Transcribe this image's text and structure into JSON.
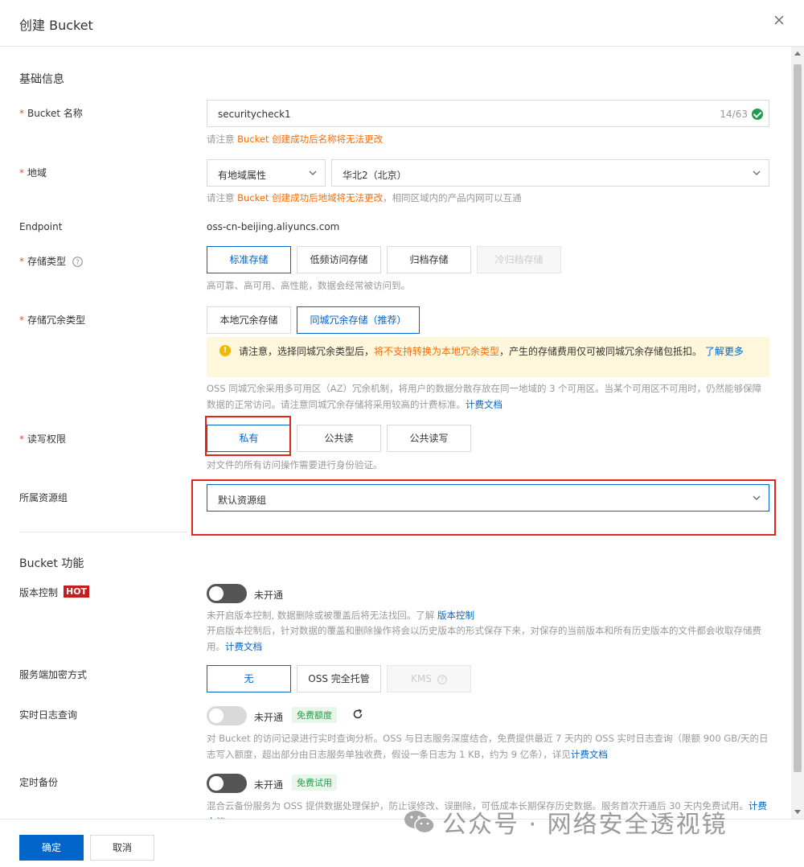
{
  "dialog": {
    "title": "创建 Bucket"
  },
  "basic": {
    "section_title": "基础信息",
    "bucket_name": {
      "label": "Bucket 名称",
      "value": "securitycheck1",
      "count": "14/63",
      "hint_prefix": "请注意 ",
      "hint_orange": "Bucket 创建成功后名称将无法更改"
    },
    "region": {
      "label": "地域",
      "type_value": "有地域属性",
      "region_value": "华北2（北京）",
      "hint_prefix": "请注意 ",
      "hint_orange": "Bucket 创建成功后地域将无法更改",
      "hint_suffix": "，相同区域内的产品内网可以互通"
    },
    "endpoint": {
      "label": "Endpoint",
      "value": "oss-cn-beijing.aliyuncs.com"
    },
    "storage_class": {
      "label": "存储类型",
      "options": [
        "标准存储",
        "低频访问存储",
        "归档存储",
        "冷归档存储"
      ],
      "hint": "高可靠、高可用、高性能，数据会经常被访问到。"
    },
    "redundancy": {
      "label": "存储冗余类型",
      "options": [
        "本地冗余存储",
        "同城冗余存储（推荐）"
      ],
      "notice_prefix": "请注意，选择同城冗余类型后，",
      "notice_red": "将不支持转换为本地冗余类型",
      "notice_suffix": "，产生的存储费用仅可被同城冗余存储包抵扣。",
      "notice_link": "了解更多",
      "desc": "OSS 同城冗余采用多可用区（AZ）冗余机制，将用户的数据分散存放在同一地域的 3 个可用区。当某个可用区不可用时，仍然能够保障数据的正常访问。请注意同城冗余存储将采用较高的计费标准。",
      "desc_link": "计费文档"
    },
    "acl": {
      "label": "读写权限",
      "options": [
        "私有",
        "公共读",
        "公共读写"
      ],
      "hint": "对文件的所有访问操作需要进行身份验证。"
    },
    "resource_group": {
      "label": "所属资源组",
      "value": "默认资源组"
    }
  },
  "features": {
    "section_title": "Bucket 功能",
    "versioning": {
      "label": "版本控制",
      "badge": "HOT",
      "state": "未开通",
      "desc1": "未开启版本控制, 数据删除或被覆盖后将无法找回。了解",
      "desc1_link": "版本控制",
      "desc2": "开启版本控制后，针对数据的覆盖和删除操作将会以历史版本的形式保存下来，对保存的当前版本和所有历史版本的文件都会收取存储费用。",
      "desc2_link": "计费文档"
    },
    "encryption": {
      "label": "服务端加密方式",
      "options": [
        "无",
        "OSS 完全托管",
        "KMS"
      ]
    },
    "realtime_log": {
      "label": "实时日志查询",
      "state": "未开通",
      "badge": "免费额度",
      "desc": "对 Bucket 的访问记录进行实时查询分析。OSS 与日志服务深度结合，免费提供最近 7 天内的 OSS 实时日志查询（限额 900 GB/天的日志写入额度，超出部分由日志服务单独收费，假设一条日志为 1 KB，约为 9 亿条），详见",
      "desc_link": "计费文档"
    },
    "backup": {
      "label": "定时备份",
      "state": "未开通",
      "badge": "免费试用",
      "desc": "混合云备份服务为 OSS 提供数据处理保护，防止误修改、误删除，可低成本长期保存历史数据。服务首次开通后 30 天内免费试用。",
      "desc_link": "计费文档"
    }
  },
  "footer": {
    "confirm": "确定",
    "cancel": "取消"
  },
  "watermark": {
    "text": "公众号 · 网络安全透视镜"
  },
  "colors": {
    "primary": "#0064c8",
    "orange": "#ff6a00",
    "red_box": "#e0261b",
    "hot": "#c51d1d"
  }
}
